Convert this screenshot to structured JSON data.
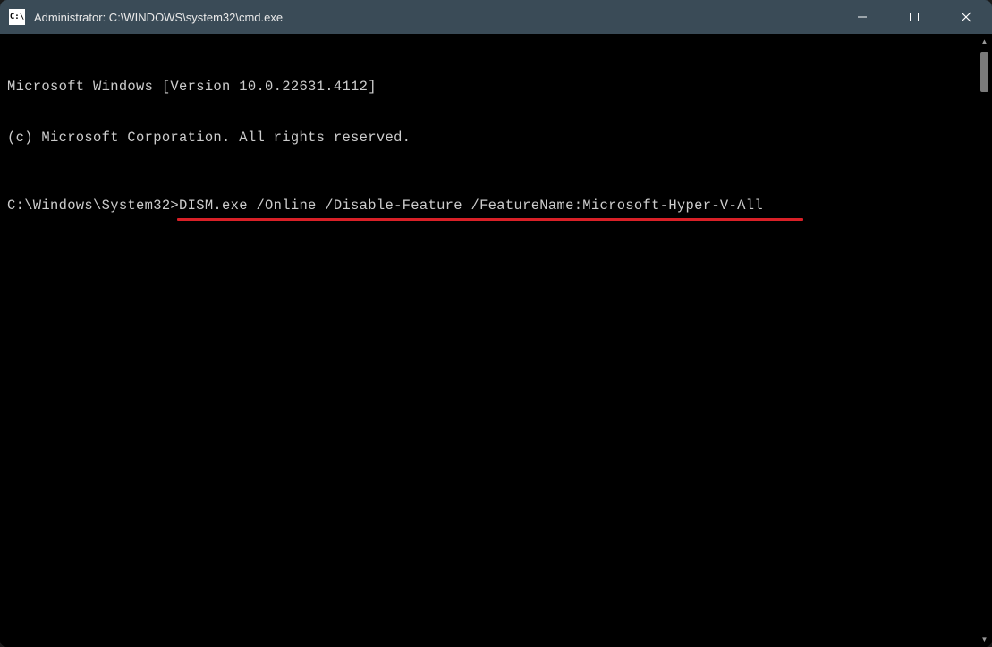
{
  "window": {
    "title": "Administrator: C:\\WINDOWS\\system32\\cmd.exe",
    "icon_label": "C:\\"
  },
  "terminal": {
    "line1": "Microsoft Windows [Version 10.0.22631.4112]",
    "line2": "(c) Microsoft Corporation. All rights reserved.",
    "prompt": "C:\\Windows\\System32>",
    "command": "DISM.exe /Online /Disable-Feature /FeatureName:Microsoft-Hyper-V-All"
  },
  "annotation": {
    "underline_color": "#d92027"
  }
}
